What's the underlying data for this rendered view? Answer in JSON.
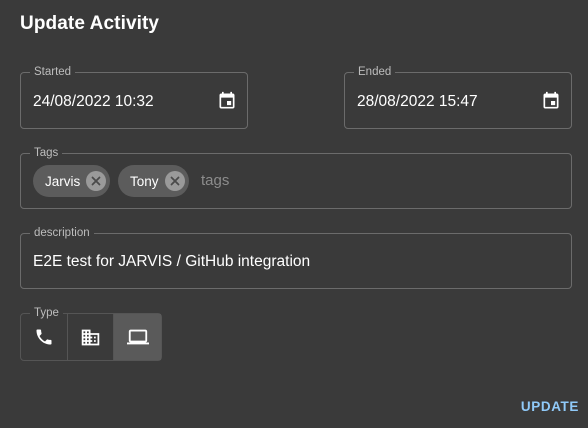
{
  "dialog": {
    "title": "Update Activity",
    "update_label": "UPDATE"
  },
  "started": {
    "label": "Started",
    "value": "24/08/2022 10:32",
    "icon": "calendar-icon"
  },
  "ended": {
    "label": "Ended",
    "value": "28/08/2022 15:47",
    "icon": "calendar-icon"
  },
  "tags": {
    "label": "Tags",
    "chips": [
      "Jarvis",
      "Tony"
    ],
    "placeholder": "tags"
  },
  "description": {
    "label": "description",
    "value": "E2E test for JARVIS / GitHub integration"
  },
  "type": {
    "label": "Type",
    "options": [
      {
        "icon": "phone-icon",
        "selected": false
      },
      {
        "icon": "office-building-icon",
        "selected": false
      },
      {
        "icon": "laptop-icon",
        "selected": true
      }
    ]
  },
  "colors": {
    "background": "#3a3a3a",
    "accent": "#90caf9",
    "chip": "#5c5c5c"
  }
}
